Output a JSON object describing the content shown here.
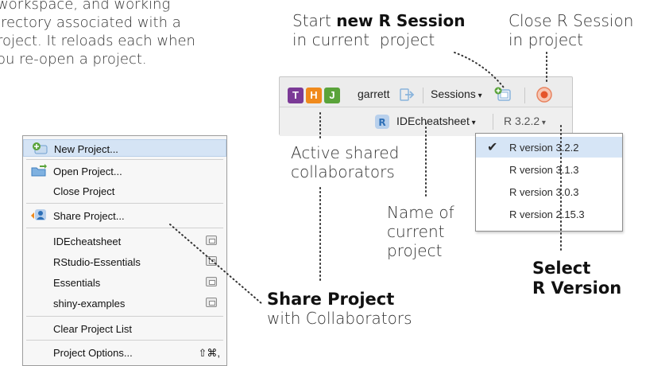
{
  "intro": {
    "lines": [
      "workspace, and working",
      "irectory associated with a",
      "roject. It reloads each when",
      "ou re-open a project."
    ]
  },
  "annotations": {
    "new_session": {
      "prefix": "Start ",
      "bold": "new R Session",
      "line2": "in current  project"
    },
    "close_session": {
      "line1": "Close R Session",
      "line2": "in project"
    },
    "shared": {
      "line1": "Active shared",
      "line2": "collaborators"
    },
    "name": {
      "line1": "Name of",
      "line2": "current",
      "line3": "project"
    },
    "select": {
      "line1": "Select",
      "line2": "R Version"
    },
    "share": {
      "bold": "Share Project",
      "line2": "with Collaborators"
    }
  },
  "project_menu": {
    "items": [
      {
        "label": "New Project...",
        "icon": "new-project-icon"
      },
      {
        "label": "Open Project...",
        "icon": "open-project-icon"
      },
      {
        "label": "Close Project"
      },
      {
        "label": "Share Project...",
        "icon": "share-project-icon"
      },
      {
        "label": "IDEcheatsheet",
        "icon": "project-file-icon"
      },
      {
        "label": "RStudio-Essentials",
        "icon": "project-file-icon"
      },
      {
        "label": "Essentials",
        "icon": "project-file-icon"
      },
      {
        "label": "shiny-examples",
        "icon": "project-file-icon"
      },
      {
        "label": "Clear Project List"
      },
      {
        "label": "Project Options...",
        "shortcut": "⇧⌘,"
      }
    ]
  },
  "toolbar": {
    "collaborators": [
      {
        "initial": "T",
        "color": "#7b3a96"
      },
      {
        "initial": "H",
        "color": "#f08a1c"
      },
      {
        "initial": "J",
        "color": "#5aa33a"
      }
    ],
    "user": "garrett",
    "sessions": "Sessions",
    "project": "IDEcheatsheet",
    "r_version": "R 3.2.2"
  },
  "r_versions": {
    "items": [
      "R version 3.2.2",
      "R version 3.1.3",
      "R version 3.0.3",
      "R version 2.15.3"
    ],
    "selected": "R version 3.2.2"
  }
}
